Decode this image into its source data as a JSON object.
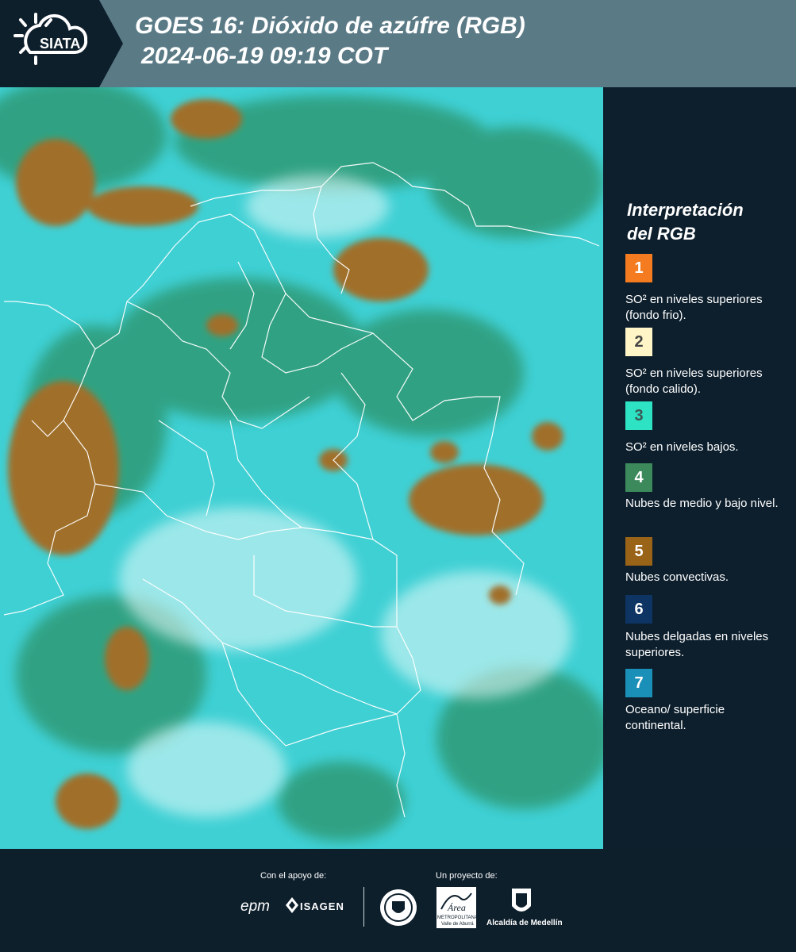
{
  "header": {
    "logo_text": "SIATA",
    "title_line1": "GOES 16: Dióxido de azúfre (RGB)",
    "title_line2": "2024-06-19 09:19 COT"
  },
  "legend": {
    "title_line1": "Interpretación",
    "title_line2": "del RGB",
    "items": [
      {
        "number": "1",
        "color": "#f47b20",
        "num_color": "#ffffff",
        "text": "SO² en niveles superiores (fondo frio)."
      },
      {
        "number": "2",
        "color": "#fff5c7",
        "num_color": "#444444",
        "text": "SO² en niveles superiores (fondo calido)."
      },
      {
        "number": "3",
        "color": "#2de3c4",
        "num_color": "#3a5a56",
        "text": "SO² en niveles bajos."
      },
      {
        "number": "4",
        "color": "#3c8a5c",
        "num_color": "#ffffff",
        "text": "Nubes de medio y bajo nivel."
      },
      {
        "number": "5",
        "color": "#9a6418",
        "num_color": "#ffffff",
        "text": "Nubes convectivas."
      },
      {
        "number": "6",
        "color": "#0d3463",
        "num_color": "#ffffff",
        "text": "Nubes delgadas en niveles superiores."
      },
      {
        "number": "7",
        "color": "#1a8fb8",
        "num_color": "#ffffff",
        "text": "Oceano/ superficie continental."
      }
    ]
  },
  "footer": {
    "support_label": "Con el apoyo de:",
    "project_label": "Un proyecto de:",
    "sponsor_epm": "epm",
    "sponsor_isagen": "ISAGEN",
    "partner_area_line1": "METROPOLITANA",
    "partner_area_line2": "Valle de Aburrá",
    "partner_alcaldia": "Alcaldía de Medellín"
  }
}
